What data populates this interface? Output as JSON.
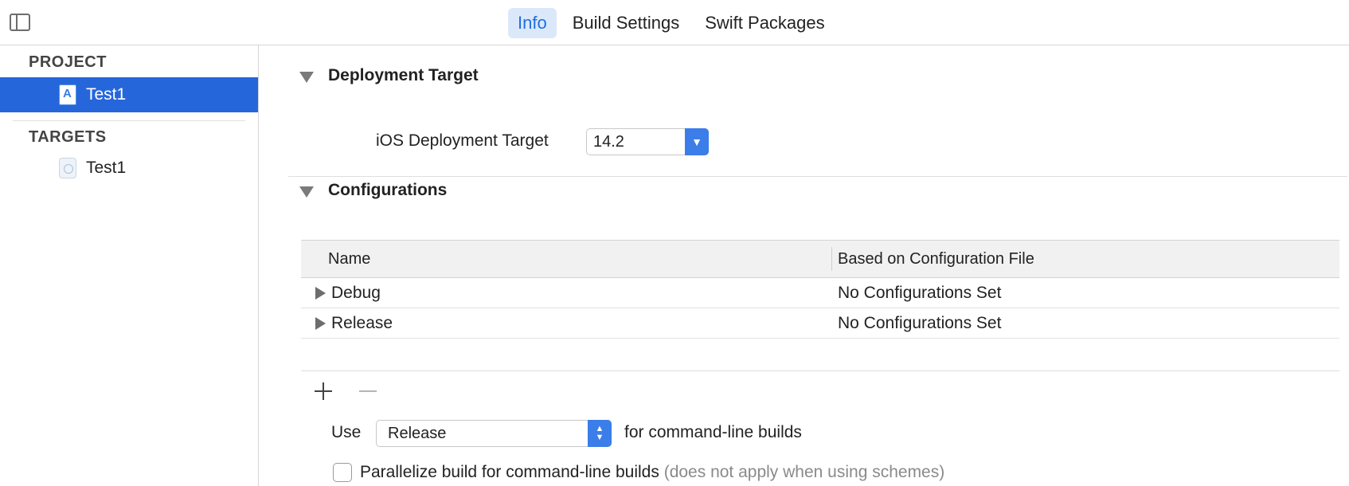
{
  "toolbar": {
    "tabs": [
      {
        "label": "Info",
        "active": true
      },
      {
        "label": "Build Settings",
        "active": false
      },
      {
        "label": "Swift Packages",
        "active": false
      }
    ]
  },
  "sidebar": {
    "project_header": "PROJECT",
    "project_item": "Test1",
    "targets_header": "TARGETS",
    "target_item": "Test1"
  },
  "deployment": {
    "title": "Deployment Target",
    "label": "iOS Deployment Target",
    "value": "14.2"
  },
  "configurations": {
    "title": "Configurations",
    "columns": [
      "Name",
      "Based on Configuration File"
    ],
    "rows": [
      {
        "name": "Debug",
        "file": "No Configurations Set"
      },
      {
        "name": "Release",
        "file": "No Configurations Set"
      }
    ],
    "use_label": "Use",
    "use_value": "Release",
    "use_suffix": "for command-line builds",
    "parallelize_label": "Parallelize build for command-line builds",
    "parallelize_note": "(does not apply when using schemes)"
  },
  "colors": {
    "accent": "#2666db",
    "tab_active_bg": "#dbe8fa",
    "tab_active_text": "#1f6fe0"
  }
}
